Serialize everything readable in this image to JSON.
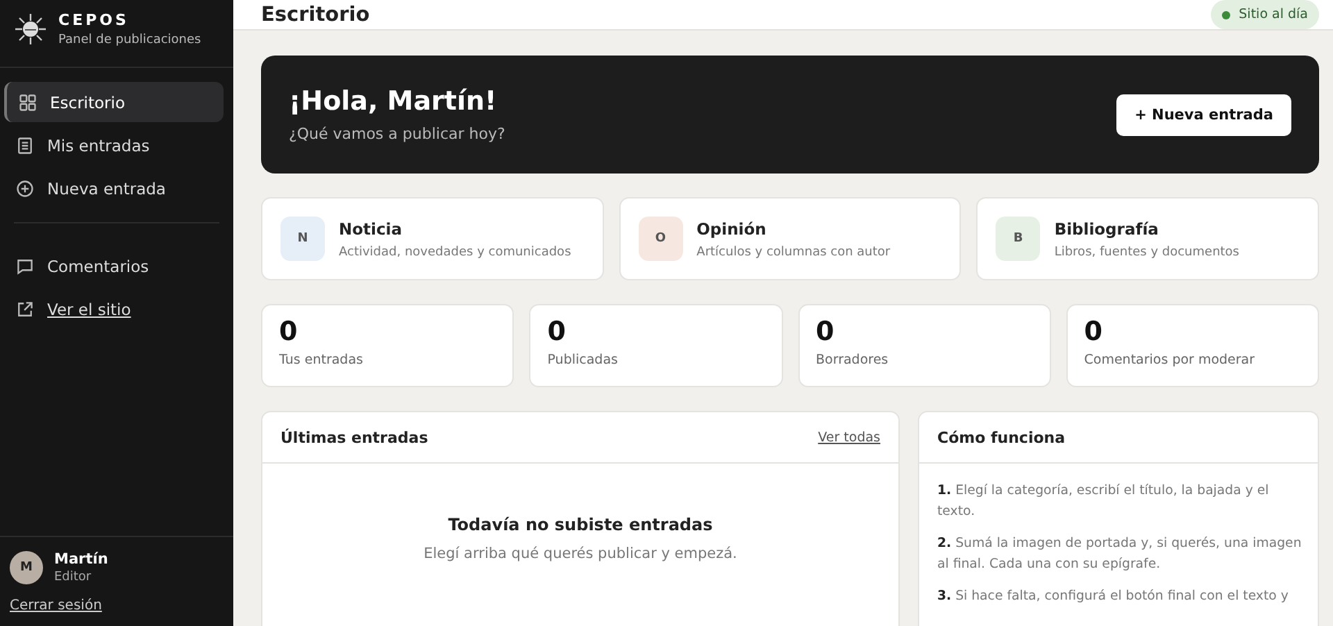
{
  "brand": {
    "name": "CEPOS",
    "subtitle": "Panel de publicaciones"
  },
  "sidebar": {
    "groups": [
      [
        {
          "label": "Escritorio",
          "selected": true,
          "kind": "nav"
        },
        {
          "label": "Mis entradas",
          "selected": false,
          "kind": "nav"
        },
        {
          "label": "Nueva entrada",
          "selected": false,
          "kind": "nav"
        }
      ],
      [
        {
          "label": "Comentarios",
          "selected": false,
          "kind": "nav"
        },
        {
          "label": "Ver el sitio",
          "selected": false,
          "kind": "link"
        }
      ]
    ]
  },
  "user": {
    "initial": "M",
    "name": "Martín",
    "role": "Editor",
    "logout": "Cerrar sesión"
  },
  "header": {
    "title": "Escritorio",
    "status": "Sitio al día"
  },
  "hero": {
    "title": "¡Hola, Martín!",
    "subtitle": "¿Qué vamos a publicar hoy?",
    "button": "+ Nueva entrada"
  },
  "categories": [
    {
      "letter": "N",
      "title": "Noticia",
      "description": "Actividad, novedades y comunicados",
      "color": "#e6eef8"
    },
    {
      "letter": "O",
      "title": "Opinión",
      "description": "Artículos y columnas con autor",
      "color": "#f6e8e0"
    },
    {
      "letter": "B",
      "title": "Bibliografía",
      "description": "Libros, fuentes y documentos",
      "color": "#e6f0e4"
    }
  ],
  "stats": [
    {
      "value": "0",
      "label": "Tus entradas"
    },
    {
      "value": "0",
      "label": "Publicadas"
    },
    {
      "value": "0",
      "label": "Borradores"
    },
    {
      "value": "0",
      "label": "Comentarios por moderar"
    }
  ],
  "latest": {
    "title": "Últimas entradas",
    "link": "Ver todas",
    "empty_title": "Todavía no subiste entradas",
    "empty_text": "Elegí arriba qué querés publicar y empezá."
  },
  "howto": {
    "title": "Cómo funciona",
    "steps": [
      {
        "number": "1.",
        "text": "Elegí la categoría, escribí el título, la bajada y el texto."
      },
      {
        "number": "2.",
        "text": "Sumá la imagen de portada y, si querés, una imagen al final. Cada una con su epígrafe."
      },
      {
        "number": "3.",
        "text": "Si hace falta, configurá el botón final con el texto y"
      }
    ]
  }
}
